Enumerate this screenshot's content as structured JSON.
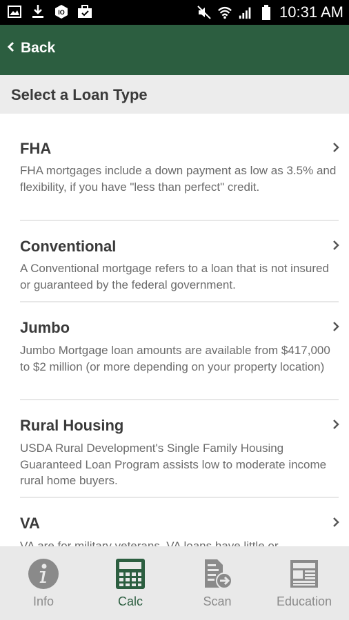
{
  "status_bar": {
    "time": "10:31 AM",
    "icons": [
      "image-icon",
      "download-icon",
      "app-icon",
      "briefcase-icon",
      "mute-icon",
      "wifi-icon",
      "signal-icon",
      "battery-icon"
    ]
  },
  "app_bar": {
    "back_label": "Back",
    "back_icon": "chevron-left-icon",
    "color": "#2c5e40"
  },
  "section": {
    "title": "Select a Loan Type"
  },
  "loans": [
    {
      "title": "FHA",
      "description": "FHA mortgages include a down payment as low as 3.5% and flexibility, if you have \"less than perfect\" credit."
    },
    {
      "title": "Conventional",
      "description": "A Conventional mortgage refers to a loan that is not insured or guaranteed by the federal government."
    },
    {
      "title": "Jumbo",
      "description": "Jumbo Mortgage loan amounts are available from $417,000 to $2 million (or more depending on your property location)"
    },
    {
      "title": "Rural Housing",
      "description": "USDA Rural Development's Single Family Housing Guaranteed Loan Program assists low to moderate income rural home buyers."
    },
    {
      "title": "VA",
      "description": "VA are for military veterans. VA loans have little or"
    }
  ],
  "tabs": [
    {
      "label": "Info",
      "icon": "info-icon",
      "active": false
    },
    {
      "label": "Calc",
      "icon": "calculator-icon",
      "active": true
    },
    {
      "label": "Scan",
      "icon": "scan-document-icon",
      "active": false
    },
    {
      "label": "Education",
      "icon": "newspaper-icon",
      "active": false
    }
  ],
  "colors": {
    "accent": "#2c5e40",
    "tab_inactive": "#8a8a8a",
    "tab_bar_bg": "#e9e9e9"
  }
}
